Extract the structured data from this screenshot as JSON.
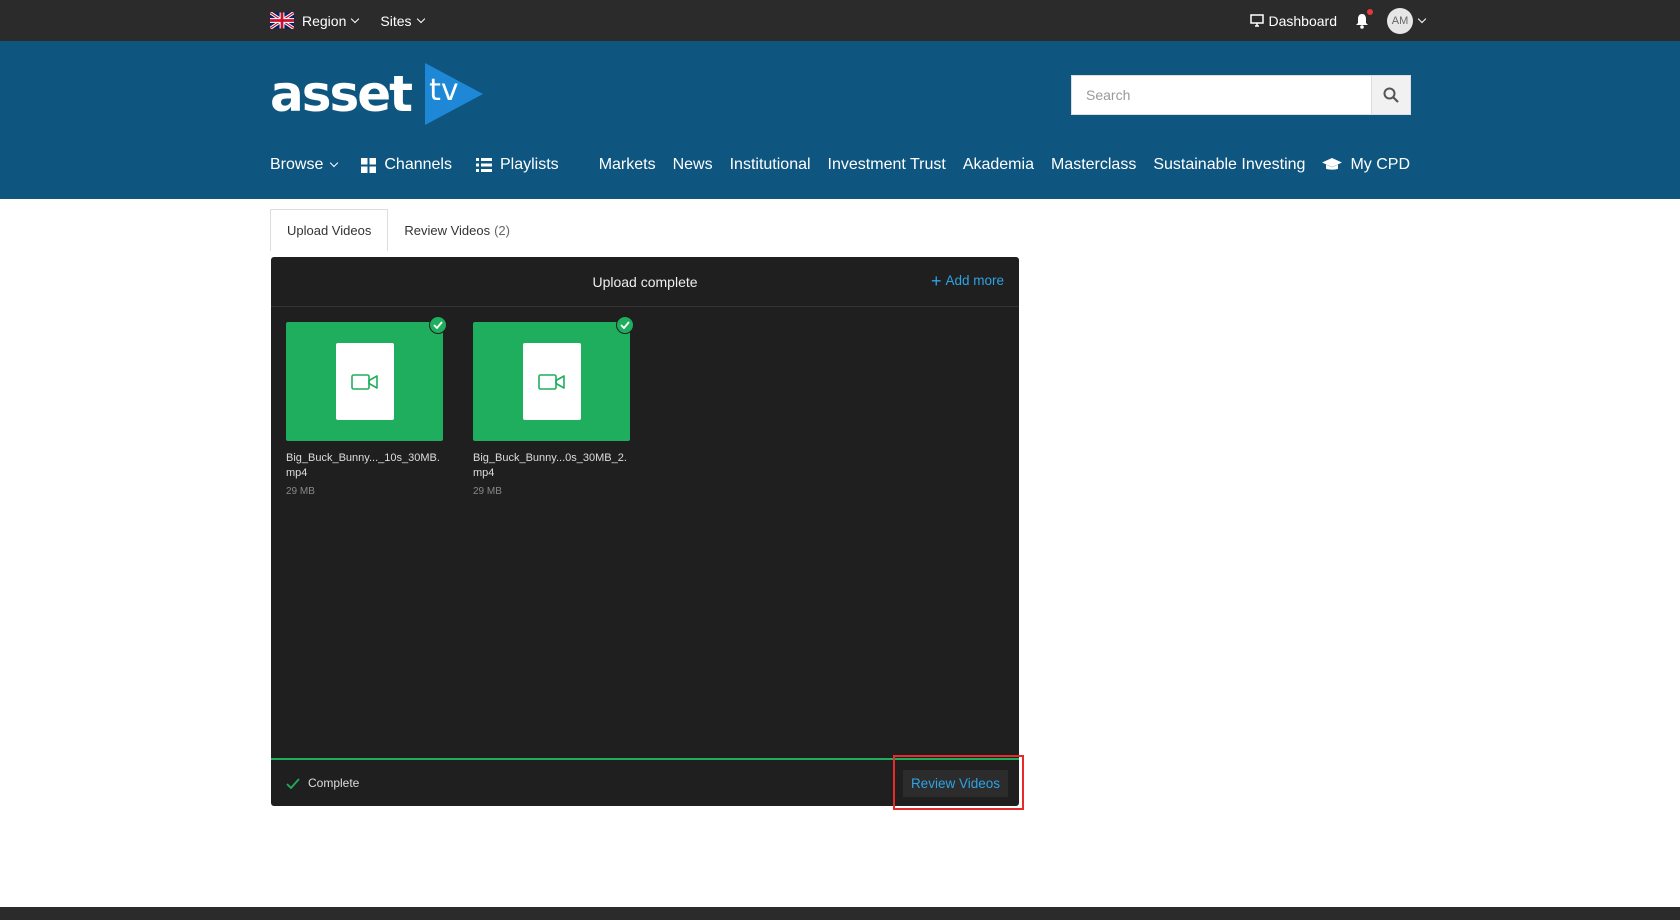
{
  "topbar": {
    "region_label": "Region",
    "sites_label": "Sites",
    "dashboard_label": "Dashboard",
    "avatar_initials": "AM"
  },
  "header": {
    "logo_text": "asset",
    "logo_tv": "tv",
    "search_placeholder": "Search"
  },
  "nav": {
    "browse": "Browse",
    "channels": "Channels",
    "playlists": "Playlists",
    "items": [
      "Markets",
      "News",
      "Institutional",
      "Investment Trust",
      "Akademia",
      "Masterclass",
      "Sustainable Investing"
    ],
    "my_cpd": "My CPD"
  },
  "tabs": {
    "upload": "Upload Videos",
    "review": "Review Videos",
    "review_count": "(2)"
  },
  "upload": {
    "status_title": "Upload complete",
    "add_more": "Add more",
    "files": [
      {
        "name": "Big_Buck_Bunny..._10s_30MB.mp4",
        "size": "29 MB"
      },
      {
        "name": "Big_Buck_Bunny...0s_30MB_2.mp4",
        "size": "29 MB"
      }
    ],
    "progress": 1.0,
    "footer_status": "Complete",
    "review_button": "Review Videos"
  },
  "colors": {
    "topbar": "#2b2b2b",
    "header": "#0e5580",
    "accent": "#2ea3e6",
    "success": "#1fae5d",
    "highlight": "#e52b2b"
  }
}
